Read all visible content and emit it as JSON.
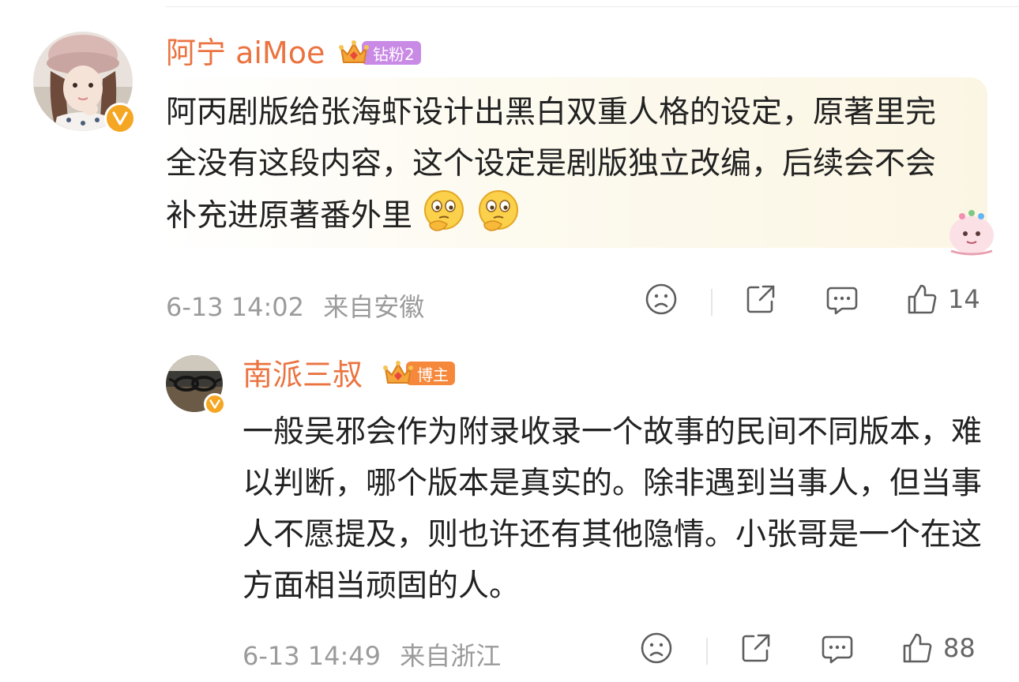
{
  "comments": [
    {
      "username": "阿宁 aiMoe",
      "badge": {
        "label": "钻粉2",
        "color": "#c98ae6"
      },
      "text": "阿丙剧版给张海虾设计出黑白双重人格的设定，原著里完全没有这段内容，这个设定是剧版独立改编，后续会不会补充进原著番外里",
      "emojis": [
        "thinking-face-emoji",
        "thinking-face-emoji"
      ],
      "time": "6-13 14:02",
      "location": "来自安徽",
      "likes": "14",
      "highlighted": true
    },
    {
      "username": "南派三叔",
      "badge": {
        "label": "博主",
        "color": "#f6883b"
      },
      "text": "一般吴邪会作为附录收录一个故事的民间不同版本，难以判断，哪个版本是真实的。除非遇到当事人，但当事人不愿提及，则也许还有其他隐情。小张哥是一个在这方面相当顽固的人。",
      "time": "6-13 14:49",
      "location": "来自浙江",
      "likes": "88",
      "highlighted": false
    }
  ],
  "icons": {
    "dislike": "frown-face-icon",
    "share": "share-icon",
    "comment": "comment-bubble-icon",
    "like": "thumbs-up-icon",
    "verified": "verified-v-icon",
    "crown": "crown-icon"
  },
  "colors": {
    "username": "#eb7340",
    "text": "#222222",
    "meta": "#9b9b9b",
    "verified": "#f5a623"
  }
}
